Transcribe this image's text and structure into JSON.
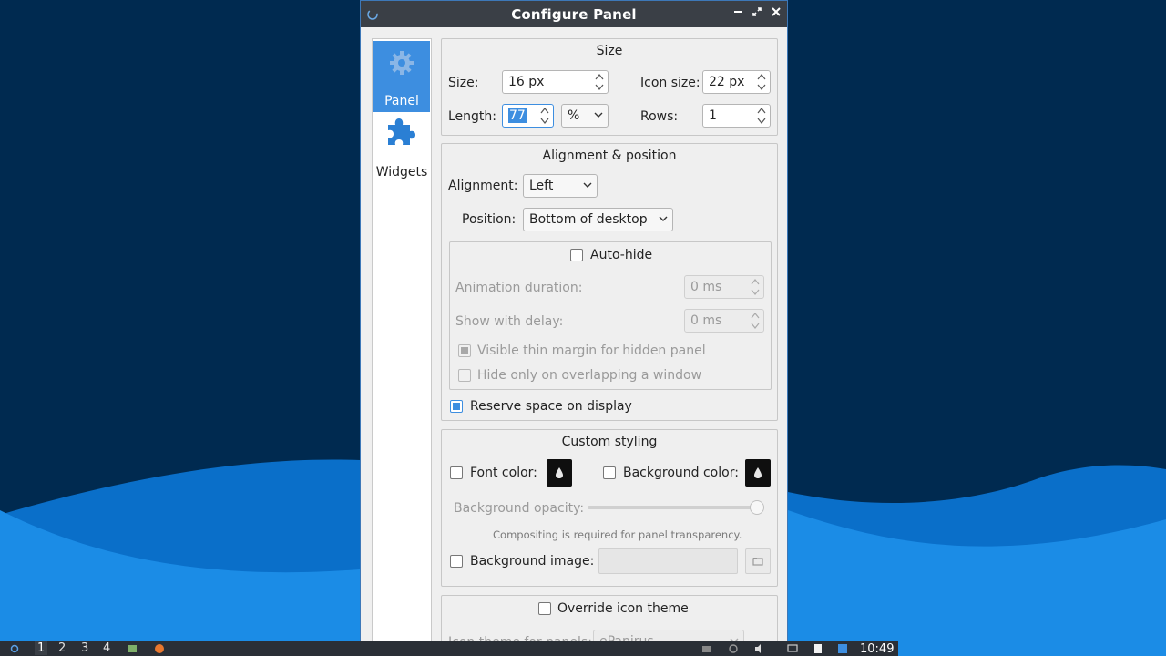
{
  "window": {
    "title": "Configure Panel"
  },
  "sidebar": {
    "items": [
      {
        "label": "Panel",
        "icon": "gear-icon"
      },
      {
        "label": "Widgets",
        "icon": "puzzle-icon"
      }
    ]
  },
  "size_group": {
    "title": "Size",
    "size_label": "Size:",
    "size_value": "16 px",
    "icon_size_label": "Icon size:",
    "icon_size_value": "22 px",
    "length_label": "Length:",
    "length_value": "77",
    "length_unit": "%",
    "rows_label": "Rows:",
    "rows_value": "1"
  },
  "alignment_group": {
    "title": "Alignment & position",
    "alignment_label": "Alignment:",
    "alignment_value": "Left",
    "position_label": "Position:",
    "position_value": "Bottom of desktop",
    "autohide_label": "Auto-hide",
    "animation_label": "Animation duration:",
    "animation_value": "0 ms",
    "delay_label": "Show with delay:",
    "delay_value": "0 ms",
    "thin_margin_label": "Visible thin margin for hidden panel",
    "overlap_label": "Hide only on overlapping a window",
    "reserve_label": "Reserve space on display"
  },
  "styling_group": {
    "title": "Custom styling",
    "font_color_label": "Font color:",
    "bg_color_label": "Background color:",
    "opacity_label": "Background opacity:",
    "opacity_value": 1.0,
    "compositing_note": "Compositing is required for panel transparency.",
    "bg_image_label": "Background image:"
  },
  "icon_theme_group": {
    "override_label": "Override icon theme",
    "theme_label": "Icon theme for panels:",
    "theme_value": "ePapirus"
  },
  "taskbar": {
    "workspaces": [
      "1",
      "2",
      "3",
      "4"
    ],
    "clock": "10:49"
  },
  "colors": {
    "accent": "#3d8ee0",
    "titlebar": "#3a3f46",
    "desktop": "#002a50"
  }
}
